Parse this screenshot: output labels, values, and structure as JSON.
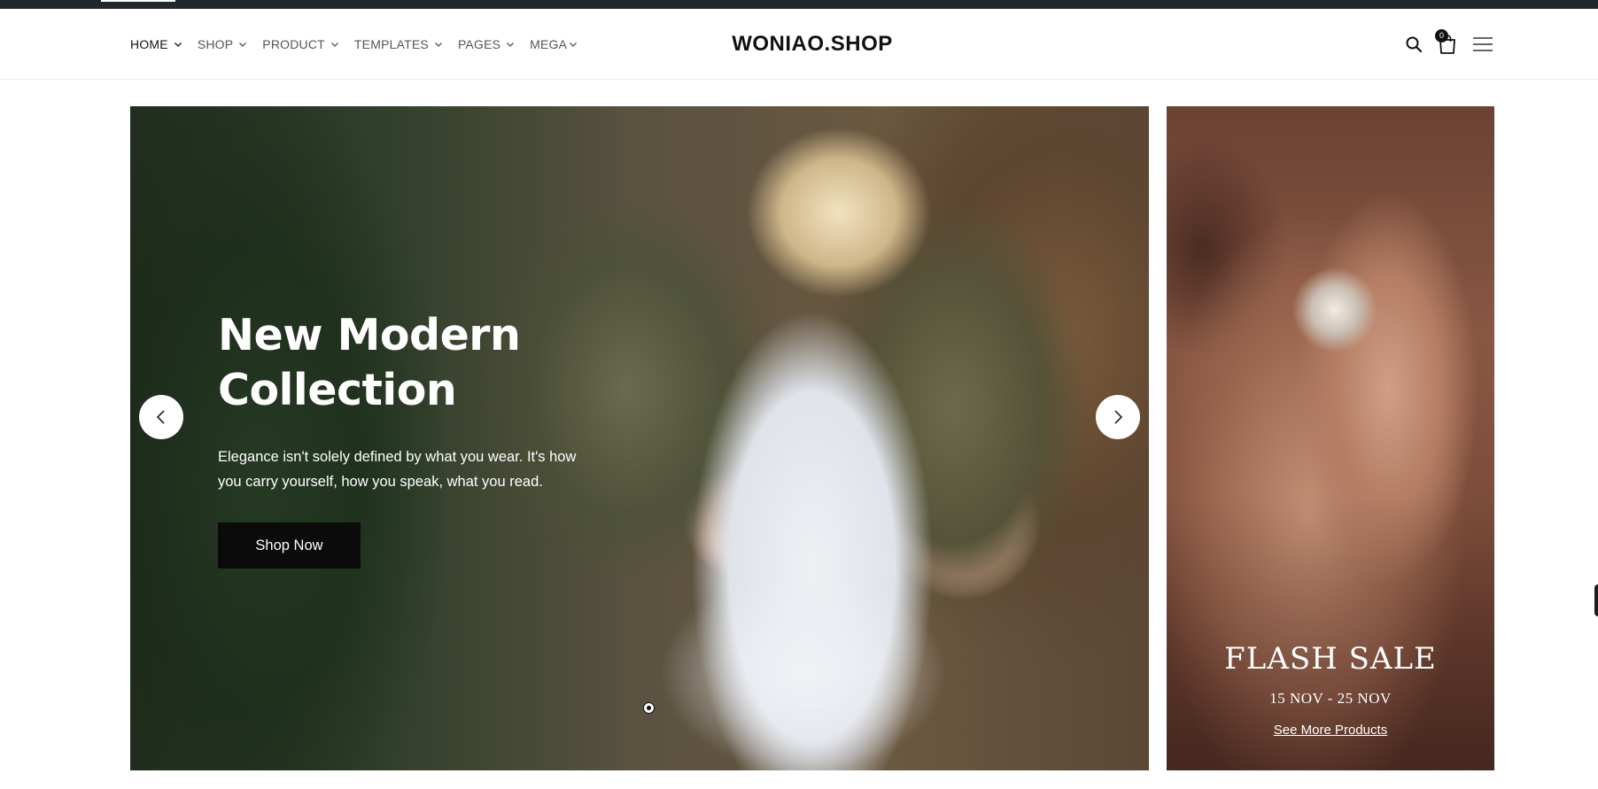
{
  "header": {
    "logo": "WONIAO.SHOP",
    "nav": [
      {
        "label": "HOME"
      },
      {
        "label": "SHOP"
      },
      {
        "label": "PRODUCT"
      },
      {
        "label": "TEMPLATES"
      },
      {
        "label": "PAGES"
      },
      {
        "label": "MEGA"
      }
    ],
    "cart_count": "0",
    "icons": [
      "search-icon",
      "cart-icon",
      "menu-icon"
    ]
  },
  "hero": {
    "title_line1": "New Modern",
    "title_line2": "Collection",
    "description": "Elegance isn't solely defined by what you wear. It's how you carry yourself, how you speak, what you read.",
    "button": "Shop Now",
    "slides_total": 1,
    "active_slide": 1
  },
  "promo": {
    "title": "FLASH SALE",
    "dates": "15 NOV - 25 NOV",
    "link": "See More Products"
  },
  "colors": {
    "topbar": "#20272d",
    "button_bg": "#0b0b0b",
    "text": "#111111"
  }
}
